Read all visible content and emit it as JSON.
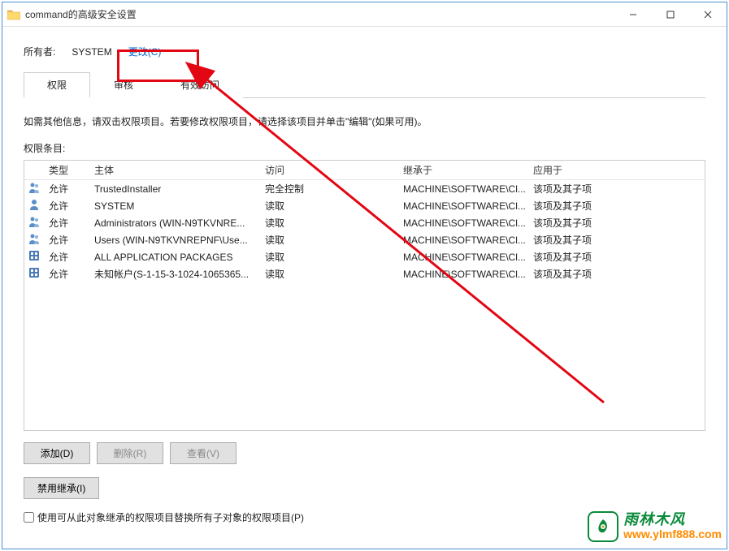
{
  "window": {
    "title": "command的高级安全设置"
  },
  "owner": {
    "label": "所有者:",
    "value": "SYSTEM",
    "change": "更改(C)"
  },
  "tabs": [
    "权限",
    "审核",
    "有效访问"
  ],
  "info": "如需其他信息，请双击权限项目。若要修改权限项目，请选择该项目并单击\"编辑\"(如果可用)。",
  "entries_label": "权限条目:",
  "columns": {
    "type": "类型",
    "principal": "主体",
    "access": "访问",
    "inherit": "继承于",
    "applies": "应用于"
  },
  "rows": [
    {
      "icon": "users",
      "type": "允许",
      "principal": "TrustedInstaller",
      "access": "完全控制",
      "inherit": "MACHINE\\SOFTWARE\\Cl...",
      "applies": "该项及其子项"
    },
    {
      "icon": "user",
      "type": "允许",
      "principal": "SYSTEM",
      "access": "读取",
      "inherit": "MACHINE\\SOFTWARE\\Cl...",
      "applies": "该项及其子项"
    },
    {
      "icon": "users",
      "type": "允许",
      "principal": "Administrators (WIN-N9TKVNRE...",
      "access": "读取",
      "inherit": "MACHINE\\SOFTWARE\\Cl...",
      "applies": "该项及其子项"
    },
    {
      "icon": "users",
      "type": "允许",
      "principal": "Users (WIN-N9TKVNREPNF\\Use...",
      "access": "读取",
      "inherit": "MACHINE\\SOFTWARE\\Cl...",
      "applies": "该项及其子项"
    },
    {
      "icon": "apps",
      "type": "允许",
      "principal": "ALL APPLICATION PACKAGES",
      "access": "读取",
      "inherit": "MACHINE\\SOFTWARE\\Cl...",
      "applies": "该项及其子项"
    },
    {
      "icon": "apps",
      "type": "允许",
      "principal": "未知帐户(S-1-15-3-1024-1065365...",
      "access": "读取",
      "inherit": "MACHINE\\SOFTWARE\\Cl...",
      "applies": "该项及其子项"
    }
  ],
  "buttons": {
    "add": "添加(D)",
    "remove": "删除(R)",
    "view": "查看(V)",
    "disable_inherit": "禁用继承(I)"
  },
  "replace_label": "使用可从此对象继承的权限项目替换所有子对象的权限项目(P)",
  "watermark": {
    "cn": "雨林木风",
    "url": "www.ylmf888.com"
  }
}
